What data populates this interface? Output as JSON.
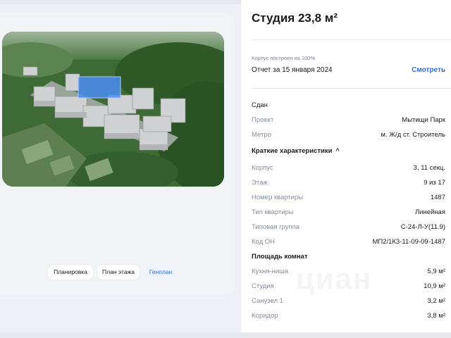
{
  "listing": {
    "title": "Студия 23,8 м²",
    "status": "Сдан"
  },
  "report": {
    "note": "Корпус построен на 100%",
    "date": "Отчет за 15 января 2024",
    "link": "Смотреть"
  },
  "project": {
    "rows": [
      {
        "key": "Проект",
        "value": "Мытищи Парк"
      },
      {
        "key": "Метро",
        "value": "м. Ж/д ст. Строитель"
      }
    ]
  },
  "characteristics": {
    "title": "Краткие характеристики",
    "chevron": "^",
    "rows": [
      {
        "key": "Корпус",
        "value": "3, 11 секц."
      },
      {
        "key": "Этаж",
        "value": "9 из 17"
      },
      {
        "key": "Номер квартиры",
        "value": "1487"
      },
      {
        "key": "Тип квартиры",
        "value": "Линейная"
      },
      {
        "key": "Типовая группа",
        "value": "С-24-Л-У(11.9)"
      },
      {
        "key": "Код ОН",
        "value": "МП2/1К3-11-09-09-1487"
      }
    ]
  },
  "rooms": {
    "title": "Площадь комнат",
    "rows": [
      {
        "key": "Кухня-ниша",
        "value": "5,9 м²"
      },
      {
        "key": "Студия",
        "value": "10,9 м²"
      },
      {
        "key": "Санузел 1",
        "value": "3,2 м²"
      },
      {
        "key": "Коридор",
        "value": "3,8 м²"
      }
    ]
  },
  "tabs": [
    {
      "label": "Планировка",
      "active": false
    },
    {
      "label": "План этажа",
      "active": false
    },
    {
      "label": "Генплан",
      "active": true
    }
  ],
  "watermark": "циан",
  "colors": {
    "accent": "#2b6ef6",
    "highlight": "#4a8df0"
  }
}
